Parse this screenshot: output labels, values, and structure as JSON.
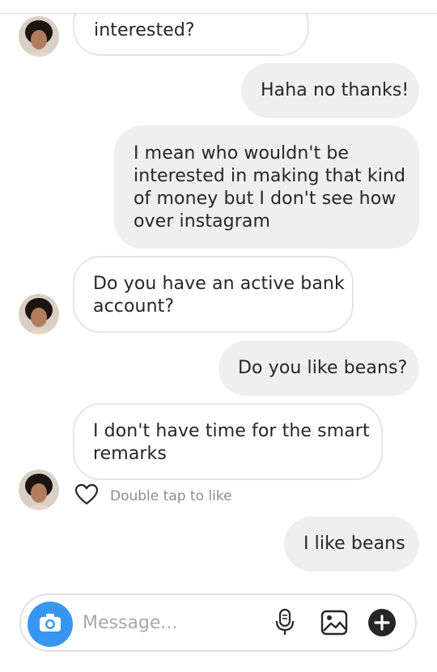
{
  "conversation": {
    "messages": [
      {
        "direction": "incoming",
        "lines": [
          "interested?"
        ]
      },
      {
        "direction": "outgoing",
        "lines": [
          "Haha no thanks!"
        ]
      },
      {
        "direction": "outgoing",
        "lines": [
          "I mean who wouldn't be",
          "interested in making that kind",
          "of money but I don't see how",
          "over instagram"
        ]
      },
      {
        "direction": "incoming",
        "lines": [
          "Do you have an active bank",
          "account?"
        ]
      },
      {
        "direction": "outgoing",
        "lines": [
          "Do you like beans?"
        ]
      },
      {
        "direction": "incoming",
        "lines": [
          "I don't have time for the smart",
          "remarks"
        ]
      },
      {
        "direction": "outgoing",
        "lines": [
          "I like beans"
        ]
      }
    ],
    "like_hint": "Double tap to like"
  },
  "composer": {
    "placeholder": "Message...",
    "icons": [
      "camera-icon",
      "microphone-icon",
      "gallery-icon",
      "add-icon"
    ]
  },
  "colors": {
    "accent_blue": "#3797f0",
    "outgoing_bubble": "#efefef",
    "incoming_border": "#e6e6e6",
    "hint_text": "#8e8e8e"
  }
}
